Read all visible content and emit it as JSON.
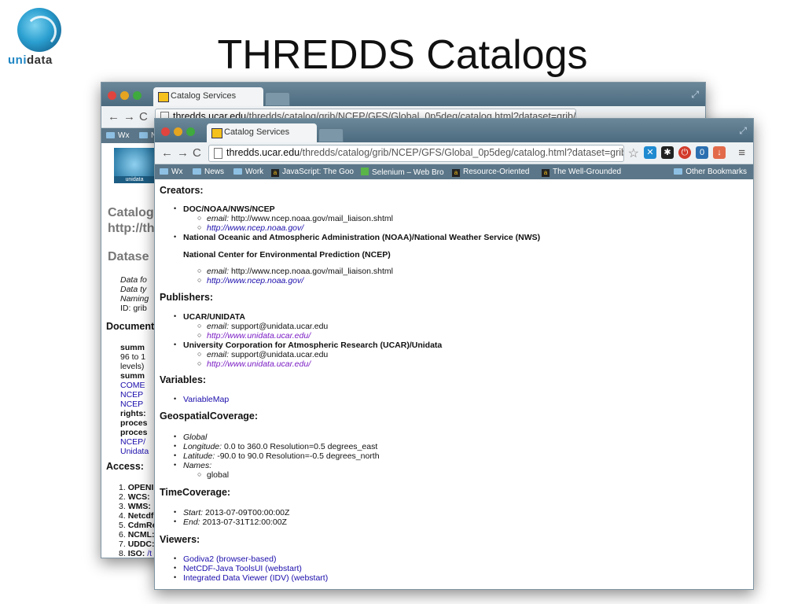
{
  "slide": {
    "title": "THREDDS Catalogs",
    "logo_text_a": "uni",
    "logo_text_b": "data"
  },
  "browser": {
    "tab_title": "Catalog Services",
    "tab_close": "×",
    "url_host": "thredds.ucar.edu",
    "url_path": "/thredds/catalog/grib/NCEP/GFS/Global_0p5deg/catalog.html?dataset=grib/NCEP/G...",
    "back_url_host": "thredds.ucar.edu",
    "back_url_path": "/thredds/catalog/grib/NCEP/GFS/Global_0p5deg/catalog.html?dataset=grib/NCEP/G...",
    "bookmarks": [
      "Wx",
      "News",
      "Work",
      "JavaScript: The Goo",
      "Selenium – Web Bro",
      "Resource-Oriented",
      "The Well-Grounded"
    ],
    "other_bookmarks": "Other Bookmarks",
    "back_bookmarks": [
      "Wx",
      "N"
    ]
  },
  "back_window": {
    "logo_caption": "unidata",
    "heading1": "Catalog",
    "heading2": "http://th",
    "dataset_heading": "Datase",
    "dataset_items": [
      "Data fo",
      "Data ty",
      "Naming",
      "ID: grib"
    ],
    "documentation_heading": "Document",
    "doc_items": [
      "summ",
      "96 to 1",
      "levels)",
      "summ",
      "COME",
      "NCEP",
      "NCEP",
      "rights:",
      "proces",
      "proces",
      "NCEP/",
      "Unidata"
    ],
    "access_heading": "Access:",
    "access_items": [
      "1.",
      "OPENI",
      "2.",
      "WCS:",
      "3.",
      "WMS:",
      "4.",
      "Netcdf",
      "5.",
      "CdmRe",
      "6.",
      "NCML:",
      "7.",
      "UDDC:",
      "8.",
      "ISO:",
      "/t"
    ]
  },
  "content": {
    "creators_heading": "Creators:",
    "creator1_name": "DOC/NOAA/NWS/NCEP",
    "creator1_email_label": "email:",
    "creator1_email": "http://www.ncep.noaa.gov/mail_liaison.shtml",
    "creator1_url": "http://www.ncep.noaa.gov/",
    "creator2_name": "National Oceanic and Atmospheric Administration (NOAA)/National Weather Service (NWS)",
    "creator2_sub": "National Center for Environmental Prediction (NCEP)",
    "creator2_email_label": "email:",
    "creator2_email": "http://www.ncep.noaa.gov/mail_liaison.shtml",
    "creator2_url": "http://www.ncep.noaa.gov/",
    "publishers_heading": "Publishers:",
    "pub1_name": "UCAR/UNIDATA",
    "pub1_email_label": "email:",
    "pub1_email": "support@unidata.ucar.edu",
    "pub1_url": "http://www.unidata.ucar.edu/",
    "pub2_name": "University Corporation for Atmospheric Research (UCAR)/Unidata",
    "pub2_email_label": "email:",
    "pub2_email": "support@unidata.ucar.edu",
    "pub2_url": "http://www.unidata.ucar.edu/",
    "variables_heading": "Variables:",
    "variable_map": "VariableMap",
    "geo_heading": "GeospatialCoverage:",
    "geo_global": "Global",
    "geo_lon_label": "Longitude:",
    "geo_lon": "0.0 to 360.0 Resolution=0.5 degrees_east",
    "geo_lat_label": "Latitude:",
    "geo_lat": "-90.0 to 90.0 Resolution=-0.5 degrees_north",
    "geo_names_label": "Names:",
    "geo_name1": "global",
    "time_heading": "TimeCoverage:",
    "time_start_label": "Start:",
    "time_start": "2013-07-09T00:00:00Z",
    "time_end_label": "End:",
    "time_end": "2013-07-31T12:00:00Z",
    "viewers_heading": "Viewers:",
    "viewer1": "Godiva2 (browser-based)",
    "viewer2": "NetCDF-Java ToolsUI (webstart)",
    "viewer3": "Integrated Data Viewer (IDV) (webstart)"
  },
  "icons": {
    "back": "←",
    "forward": "→",
    "reload": "C",
    "star": "☆",
    "menu": "≡",
    "resize": "⤢",
    "bullet": "•",
    "sub_bullet": "○",
    "ext_badge": "0"
  },
  "colors": {
    "link": "#1a0dab",
    "visited": "#7a1cc4",
    "titlebar": "#5a788b"
  }
}
